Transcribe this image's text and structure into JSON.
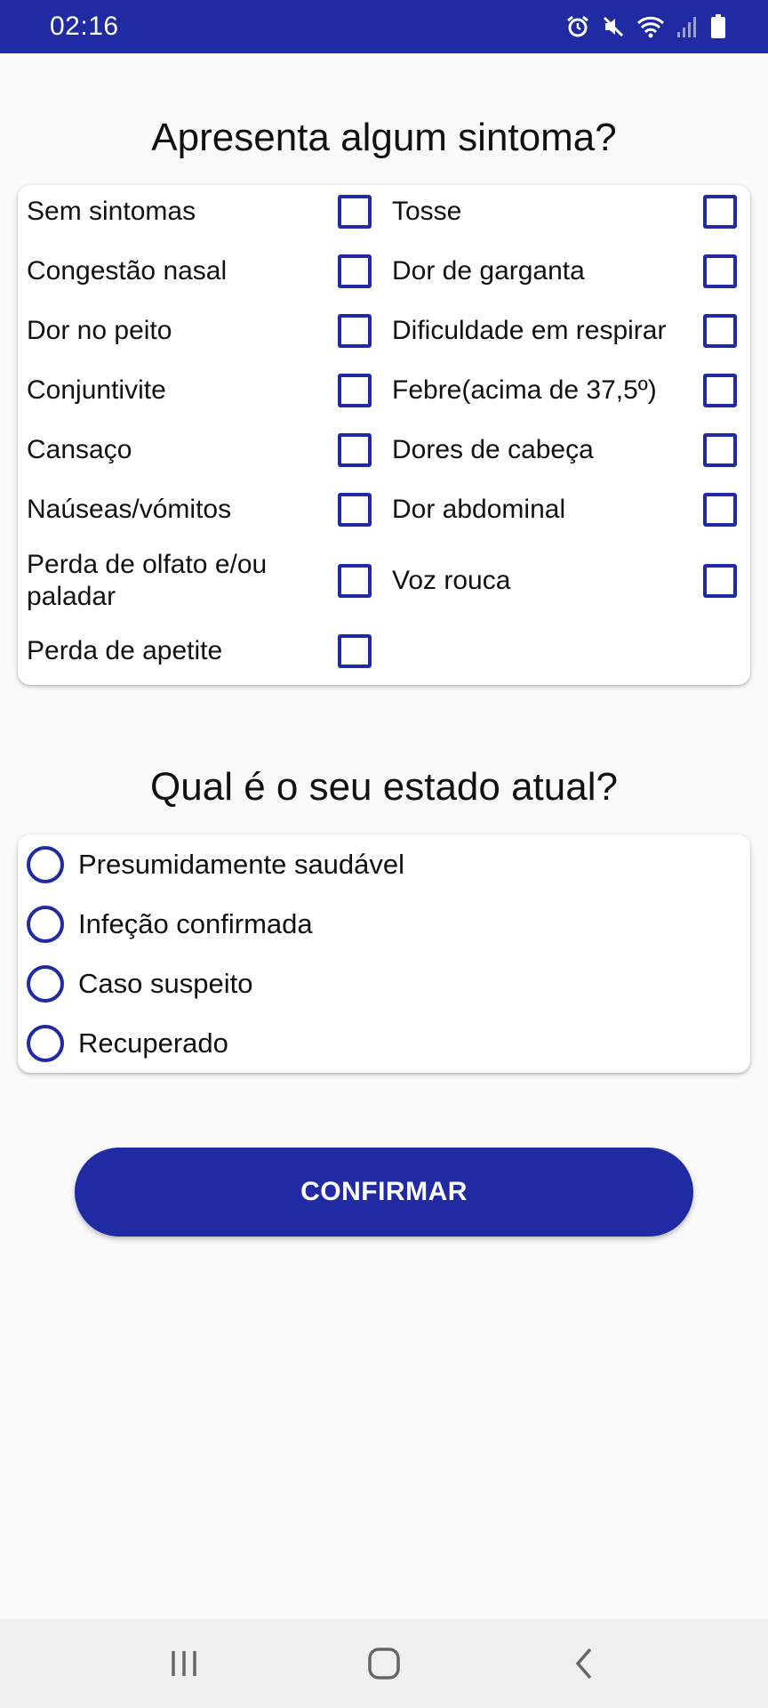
{
  "status_bar": {
    "time": "02:16",
    "icons": [
      "alarm-icon",
      "mute-icon",
      "wifi-icon",
      "signal-icon",
      "battery-icon"
    ],
    "background": "#1f2aa3"
  },
  "symptoms": {
    "title": "Apresenta algum sintoma?",
    "items": [
      {
        "label": "Sem sintomas",
        "checked": false
      },
      {
        "label": "Tosse",
        "checked": false
      },
      {
        "label": "Congestão nasal",
        "checked": false
      },
      {
        "label": "Dor de garganta",
        "checked": false
      },
      {
        "label": "Dor no peito",
        "checked": false
      },
      {
        "label": "Dificuldade em respirar",
        "checked": false
      },
      {
        "label": "Conjuntivite",
        "checked": false
      },
      {
        "label": "Febre(acima de 37,5º)",
        "checked": false
      },
      {
        "label": "Cansaço",
        "checked": false
      },
      {
        "label": "Dores de cabeça",
        "checked": false
      },
      {
        "label": "Naúseas/vómitos",
        "checked": false
      },
      {
        "label": "Dor abdominal",
        "checked": false
      },
      {
        "label": "Perda de olfato e/ou paladar",
        "checked": false
      },
      {
        "label": "Voz rouca",
        "checked": false
      },
      {
        "label": "Perda de apetite",
        "checked": false
      }
    ]
  },
  "state": {
    "title": "Qual é o seu estado atual?",
    "options": [
      {
        "label": "Presumidamente saudável",
        "selected": false
      },
      {
        "label": "Infeção confirmada",
        "selected": false
      },
      {
        "label": "Caso suspeito",
        "selected": false
      },
      {
        "label": "Recuperado",
        "selected": false
      }
    ]
  },
  "confirm_button": {
    "label": "CONFIRMAR"
  },
  "nav_bar": {
    "icons": [
      "recent-apps-icon",
      "home-icon",
      "back-icon"
    ]
  },
  "colors": {
    "accent": "#1f2aa3",
    "background": "#fafafa",
    "card": "#ffffff"
  }
}
